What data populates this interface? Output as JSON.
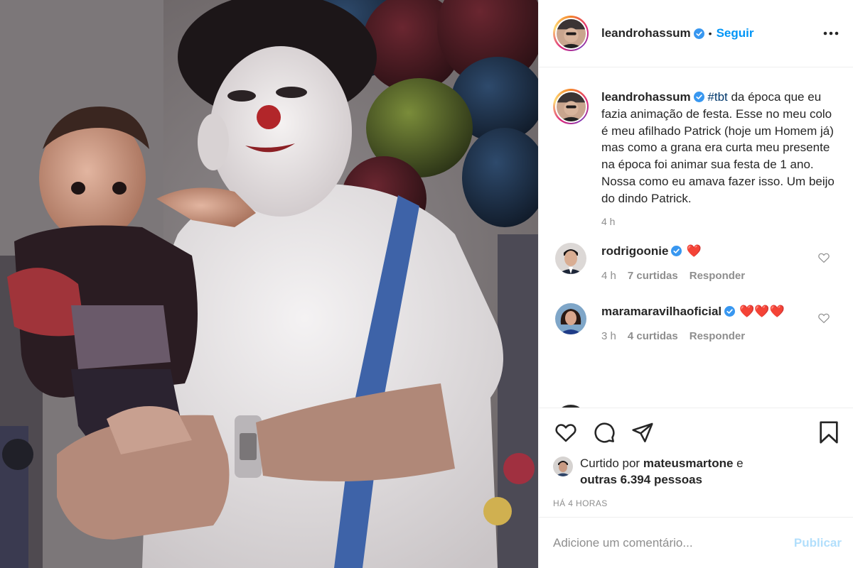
{
  "post": {
    "username": "leandrohassum",
    "verified": true,
    "follow_label": "Seguir",
    "separator": "•",
    "more_icon": "more-horizontal-icon"
  },
  "caption": {
    "username": "leandrohassum",
    "hashtag": "#tbt",
    "text": " da época que eu fazia animação de festa. Esse no meu colo é meu afilhado Patrick (hoje um Homem já) mas como a grana era curta meu presente na época foi animar sua festa de 1 ano. Nossa como eu amava fazer isso. Um beijo do dindo Patrick.",
    "time": "4 h"
  },
  "comments": [
    {
      "username": "rodrigoonie",
      "text": "❤️",
      "time": "4 h",
      "likes": "7 curtidas",
      "reply_label": "Responder"
    },
    {
      "username": "maramaravilhaoficial",
      "text": "❤️❤️❤️",
      "time": "3 h",
      "likes": "4 curtidas",
      "reply_label": "Responder"
    }
  ],
  "likes": {
    "prefix": "Curtido por ",
    "user": "mateusmartone",
    "mid": " e",
    "others": "outras 6.394 pessoas"
  },
  "posted_ago": "HÁ 4 HORAS",
  "add_comment": {
    "placeholder": "Adicione um comentário...",
    "publish_label": "Publicar"
  },
  "colors": {
    "accent": "#0095f6",
    "publish_disabled": "#b2dffc",
    "muted": "#8e8e8e",
    "heart": "#ed4956"
  }
}
